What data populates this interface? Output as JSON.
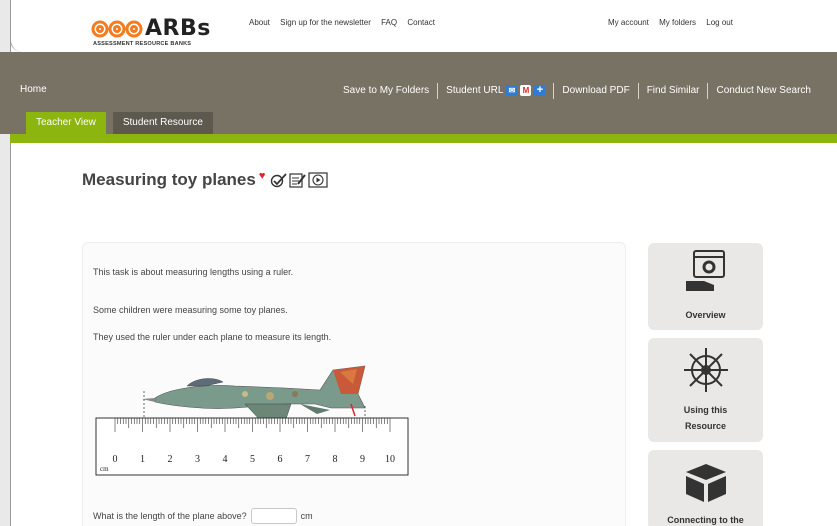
{
  "header": {
    "brand": "ARBs",
    "brand_sub": "ASSESSMENT RESOURCE BANKS",
    "nav_left": [
      "About",
      "Sign up for the newsletter",
      "FAQ",
      "Contact"
    ],
    "nav_right": [
      "My account",
      "My folders",
      "Log out"
    ]
  },
  "nav": {
    "home": "Home",
    "save": "Save to My Folders",
    "student_url": "Student URL",
    "download_pdf": "Download PDF",
    "find_similar": "Find Similar",
    "new_search": "Conduct New Search"
  },
  "tabs": [
    "Teacher View",
    "Student Resource"
  ],
  "title": "Measuring toy planes",
  "content": {
    "intro": "This task is about measuring lengths using a ruler.",
    "p1": "Some children were measuring some toy planes.",
    "p2": "They used the ruler under each plane to measure its length.",
    "question": "What is the length of the plane above?",
    "unit": "cm",
    "ruler_unit": "cm",
    "ruler_numbers": [
      "0",
      "1",
      "2",
      "3",
      "4",
      "5",
      "6",
      "7",
      "8",
      "9",
      "10"
    ]
  },
  "side": {
    "overview": "Overview",
    "using_1": "Using this",
    "using_2": "Resource",
    "connecting": "Connecting to the"
  },
  "colors": {
    "accent_green": "#8cb50f",
    "band_grey": "#777264",
    "heart_red": "#e0242b"
  }
}
